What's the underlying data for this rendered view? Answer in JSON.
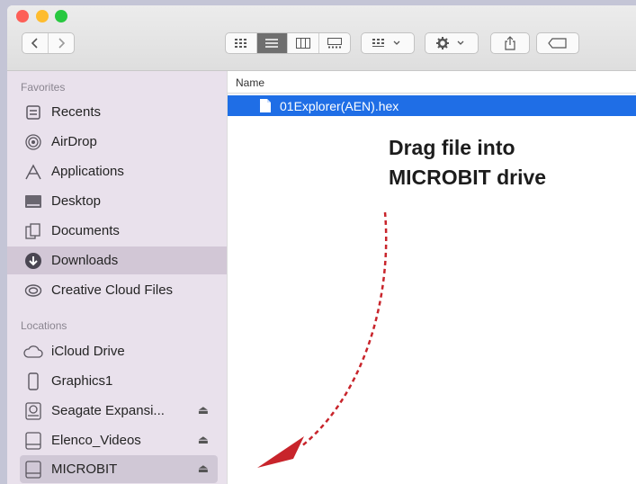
{
  "sidebar": {
    "favorites_title": "Favorites",
    "favorites": [
      {
        "label": "Recents",
        "icon": "recents-icon"
      },
      {
        "label": "AirDrop",
        "icon": "airdrop-icon"
      },
      {
        "label": "Applications",
        "icon": "applications-icon"
      },
      {
        "label": "Desktop",
        "icon": "desktop-icon"
      },
      {
        "label": "Documents",
        "icon": "documents-icon"
      },
      {
        "label": "Downloads",
        "icon": "downloads-icon",
        "selected": true
      },
      {
        "label": "Creative Cloud Files",
        "icon": "creative-cloud-icon"
      }
    ],
    "locations_title": "Locations",
    "locations": [
      {
        "label": "iCloud Drive",
        "icon": "icloud-icon"
      },
      {
        "label": "Graphics1",
        "icon": "phone-icon"
      },
      {
        "label": "Seagate Expansi...",
        "icon": "time-machine-disk-icon",
        "eject": "⏏"
      },
      {
        "label": "Elenco_Videos",
        "icon": "drive-icon",
        "eject": "⏏"
      },
      {
        "label": "MICROBIT",
        "icon": "drive-icon",
        "eject": "⏏",
        "highlighted": true
      }
    ]
  },
  "list": {
    "column_name": "Name",
    "files": [
      {
        "name": "01Explorer(AEN).hex",
        "selected": true
      }
    ]
  },
  "annotation": {
    "line1": "Drag file into",
    "line2": "MICROBIT drive",
    "arrow_color": "#c8242b"
  },
  "colors": {
    "selection_blue": "#1f6ee6",
    "sidebar_bg": "#e9e1ec"
  }
}
